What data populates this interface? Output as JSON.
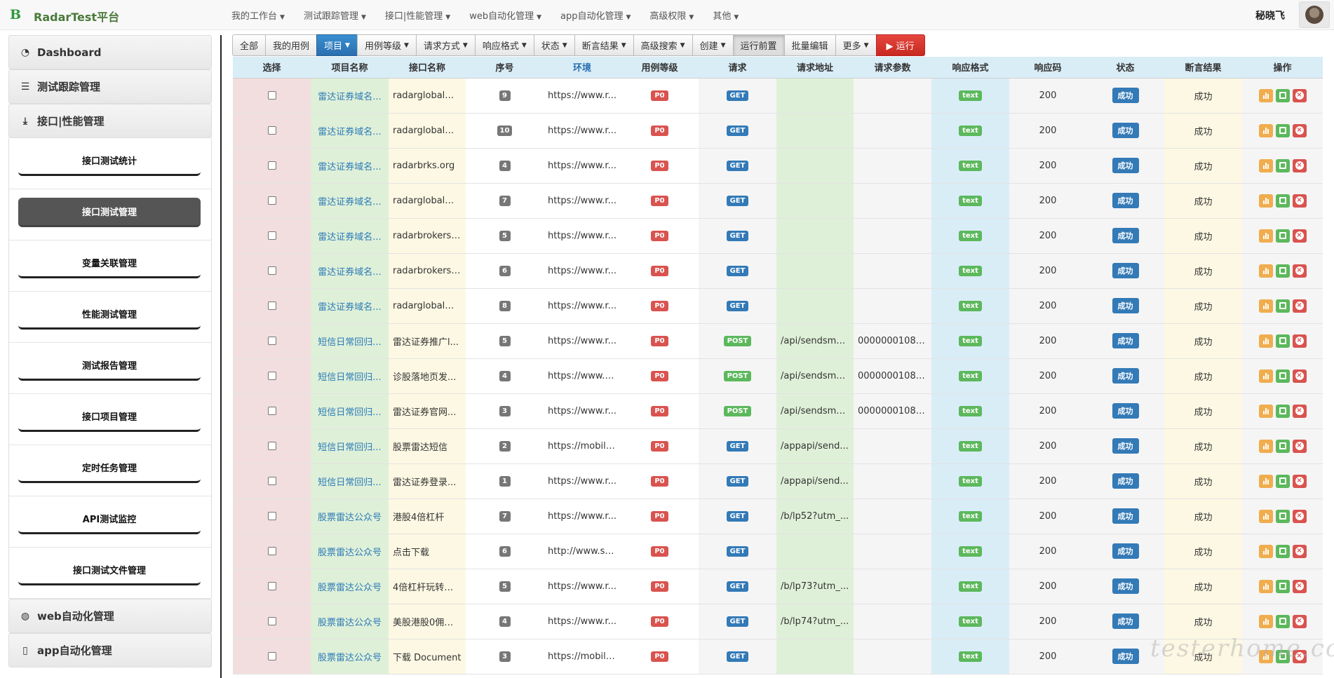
{
  "brand": {
    "logo": "B",
    "name": "RadarTest平台"
  },
  "nav": {
    "items": [
      "我的工作台",
      "测试跟踪管理",
      "接口|性能管理",
      "web自动化管理",
      "app自动化管理",
      "高级权限",
      "其他"
    ],
    "user": "秘晓飞"
  },
  "sidebar": {
    "dashboard": "Dashboard",
    "tracking": "测试跟踪管理",
    "api_perf": "接口|性能管理",
    "sub_items": [
      "接口测试统计",
      "接口测试管理",
      "变量关联管理",
      "性能测试管理",
      "测试报告管理",
      "接口项目管理",
      "定时任务管理",
      "API测试监控",
      "接口测试文件管理"
    ],
    "active_sub": "接口测试管理",
    "web_auto": "web自动化管理",
    "app_auto": "app自动化管理"
  },
  "toolbar": {
    "all": "全部",
    "mine": "我的用例",
    "project": "项目",
    "level": "用例等级",
    "method": "请求方式",
    "format": "响应格式",
    "status": "状态",
    "assert": "断言结果",
    "advanced": "高级搜索",
    "create": "创建",
    "pre": "运行前置",
    "batch": "批量编辑",
    "more": "更多",
    "run": "▶ 运行"
  },
  "table": {
    "headers": [
      "选择",
      "项目名称",
      "接口名称",
      "序号",
      "环境",
      "用例等级",
      "请求",
      "请求地址",
      "请求参数",
      "响应格式",
      "响应码",
      "状态",
      "断言结果",
      "操作"
    ],
    "rows": [
      {
        "project": "雷达证券域名...",
        "api": "radarglobalm...",
        "seq": "9",
        "env": "https://www.r...",
        "level": "P0",
        "method": "GET",
        "url": "",
        "params": "",
        "format": "text",
        "code": "200",
        "status": "成功",
        "assert": "成功"
      },
      {
        "project": "雷达证券域名...",
        "api": "radarglobalm...",
        "seq": "10",
        "env": "https://www.r...",
        "level": "P0",
        "method": "GET",
        "url": "",
        "params": "",
        "format": "text",
        "code": "200",
        "status": "成功",
        "assert": "成功"
      },
      {
        "project": "雷达证券域名...",
        "api": "radarbrks.org",
        "seq": "4",
        "env": "https://www.r...",
        "level": "P0",
        "method": "GET",
        "url": "",
        "params": "",
        "format": "text",
        "code": "200",
        "status": "成功",
        "assert": "成功"
      },
      {
        "project": "雷达证券域名...",
        "api": "radarglobalm...",
        "seq": "7",
        "env": "https://www.r...",
        "level": "P0",
        "method": "GET",
        "url": "",
        "params": "",
        "format": "text",
        "code": "200",
        "status": "成功",
        "assert": "成功"
      },
      {
        "project": "雷达证券域名...",
        "api": "radarbrokers....",
        "seq": "5",
        "env": "https://www.r...",
        "level": "P0",
        "method": "GET",
        "url": "",
        "params": "",
        "format": "text",
        "code": "200",
        "status": "成功",
        "assert": "成功"
      },
      {
        "project": "雷达证券域名...",
        "api": "radarbrokers....",
        "seq": "6",
        "env": "https://www.r...",
        "level": "P0",
        "method": "GET",
        "url": "",
        "params": "",
        "format": "text",
        "code": "200",
        "status": "成功",
        "assert": "成功"
      },
      {
        "project": "雷达证券域名...",
        "api": "radarglobalm...",
        "seq": "8",
        "env": "https://www.r...",
        "level": "P0",
        "method": "GET",
        "url": "",
        "params": "",
        "format": "text",
        "code": "200",
        "status": "成功",
        "assert": "成功"
      },
      {
        "project": "短信日常回归...",
        "api": "雷达证券推广l...",
        "seq": "5",
        "env": "https://www.r...",
        "level": "P0",
        "method": "POST",
        "url": "/api/sendsms/...",
        "params": "00000001080...",
        "format": "text",
        "code": "200",
        "status": "成功",
        "assert": "成功"
      },
      {
        "project": "短信日常回归...",
        "api": "诊股落地页发...",
        "seq": "4",
        "env": "https://www.h...",
        "level": "P0",
        "method": "POST",
        "url": "/api/sendsms/...",
        "params": "00000001080...",
        "format": "text",
        "code": "200",
        "status": "成功",
        "assert": "成功"
      },
      {
        "project": "短信日常回归...",
        "api": "雷达证券官网...",
        "seq": "3",
        "env": "https://www.r...",
        "level": "P0",
        "method": "POST",
        "url": "/api/sendsms/...",
        "params": "00000001080...",
        "format": "text",
        "code": "200",
        "status": "成功",
        "assert": "成功"
      },
      {
        "project": "短信日常回归...",
        "api": "股票雷达短信",
        "seq": "2",
        "env": "https://mobile...",
        "level": "P0",
        "method": "GET",
        "url": "/appapi/send...",
        "params": "",
        "format": "text",
        "code": "200",
        "status": "成功",
        "assert": "成功"
      },
      {
        "project": "短信日常回归...",
        "api": "雷达证券登录...",
        "seq": "1",
        "env": "https://www.r...",
        "level": "P0",
        "method": "GET",
        "url": "/appapi/send...",
        "params": "",
        "format": "text",
        "code": "200",
        "status": "成功",
        "assert": "成功"
      },
      {
        "project": "股票雷达公众号",
        "api": "港股4倍杠杆",
        "seq": "7",
        "env": "https://www.r...",
        "level": "P0",
        "method": "GET",
        "url": "/b/lp52?utm_...",
        "params": "",
        "format": "text",
        "code": "200",
        "status": "成功",
        "assert": "成功"
      },
      {
        "project": "股票雷达公众号",
        "api": "点击下载",
        "seq": "6",
        "env": "http://www.st...",
        "level": "P0",
        "method": "GET",
        "url": "",
        "params": "",
        "format": "text",
        "code": "200",
        "status": "成功",
        "assert": "成功"
      },
      {
        "project": "股票雷达公众号",
        "api": "4倍杠杆玩转港...",
        "seq": "5",
        "env": "https://www.r...",
        "level": "P0",
        "method": "GET",
        "url": "/b/lp73?utm_...",
        "params": "",
        "format": "text",
        "code": "200",
        "status": "成功",
        "assert": "成功"
      },
      {
        "project": "股票雷达公众号",
        "api": "美股港股0佣金...",
        "seq": "4",
        "env": "https://www.r...",
        "level": "P0",
        "method": "GET",
        "url": "/b/lp74?utm_...",
        "params": "",
        "format": "text",
        "code": "200",
        "status": "成功",
        "assert": "成功"
      },
      {
        "project": "股票雷达公众号",
        "api": "下载 Document",
        "seq": "3",
        "env": "https://mobile...",
        "level": "P0",
        "method": "GET",
        "url": "",
        "params": "",
        "format": "text",
        "code": "200",
        "status": "成功",
        "assert": "成功"
      }
    ]
  },
  "watermark": "testerhome.com",
  "colors": {
    "brand_green": "#2e9a3d",
    "primary": "#337ab7",
    "danger": "#d9534f",
    "success": "#5cb85c",
    "warning": "#f0ad4e"
  }
}
